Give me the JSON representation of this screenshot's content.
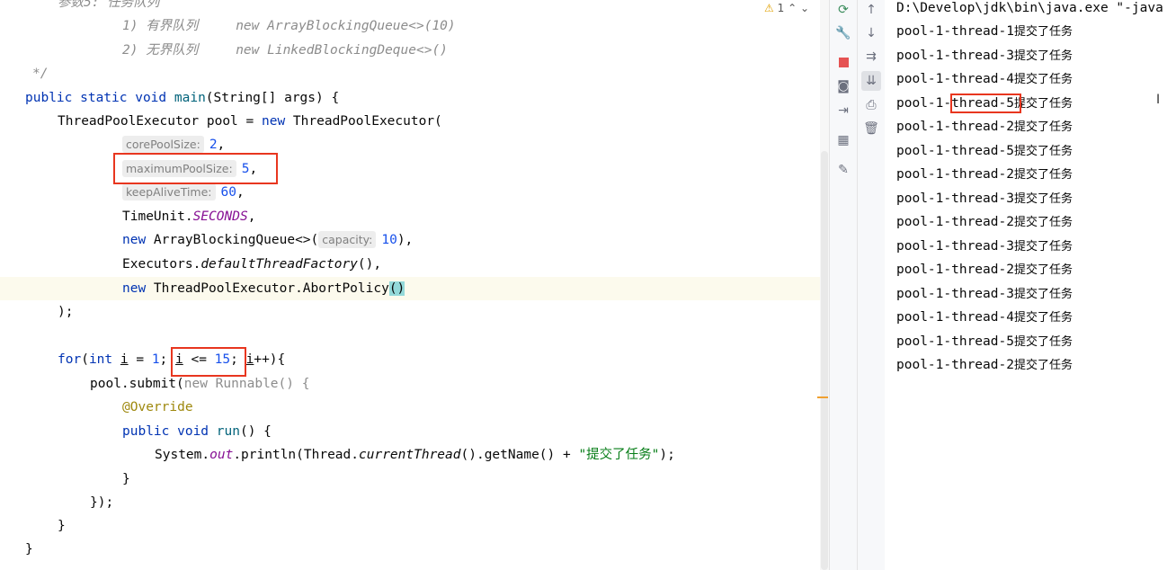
{
  "editor": {
    "warnings_count": "1",
    "lines": {
      "l0": "参数5: 任务队列",
      "l1_num": "1)",
      "l1_desc": "有界队列",
      "l1_code": "new ArrayBlockingQueue<>(10)",
      "l2_num": "2)",
      "l2_desc": "无界队列",
      "l2_code": "new LinkedBlockingDeque<>()",
      "l3": "*/",
      "main_sig_kw": "public static void ",
      "main_sig_name": "main",
      "main_sig_rest": "(String[] args) {",
      "decl_type": "ThreadPoolExecutor pool = ",
      "decl_new": "new",
      "decl_ctor": " ThreadPoolExecutor(",
      "p1_hint": "corePoolSize:",
      "p1_val": "2",
      "p2_hint": "maximumPoolSize:",
      "p2_val": "5",
      "p3_hint": "keepAliveTime:",
      "p3_val": "60",
      "p4_a": "TimeUnit.",
      "p4_b": "SECONDS",
      "p5_new": "new",
      "p5_a": " ArrayBlockingQueue<>(",
      "p5_hint": "capacity:",
      "p5_val": "10",
      "p6_a": "Executors.",
      "p6_b": "defaultThreadFactory",
      "p6_c": "(),",
      "p7_new": "new",
      "p7_a": " ThreadPoolExecutor.AbortPolicy",
      "p7_paren": "()",
      "close_ctor": ");",
      "for_kw": "for",
      "for_a": "(",
      "for_int": "int",
      "for_var": "i",
      "for_eq": " = ",
      "for_one": "1",
      "for_semi": ";",
      "for_cond_var": "i",
      "for_cond_op": " <= ",
      "for_cond_num": "15",
      "for_inc_var": "i",
      "for_inc": "++){",
      "submit_a": "pool.submit(",
      "submit_b": "new Runnable() {",
      "override": "@Override",
      "run_kw": "public void ",
      "run_name": "run",
      "run_rest": "() {",
      "print_a": "System.",
      "print_out": "out",
      "print_b": ".println(Thread.",
      "print_c": "currentThread",
      "print_d": "().getName() + ",
      "print_str": "\"提交了任务\"",
      "print_e": ");",
      "close_run": "}",
      "close_submit": "});",
      "close_for": "}",
      "close_main": "}"
    }
  },
  "toolbar": {
    "icons": [
      "rerun-icon",
      "up-arrow-icon",
      "wrench-icon",
      "down-arrow-icon",
      "soft-wrap-icon",
      "stop-icon",
      "scroll-to-end-icon",
      "camera-icon",
      "print-icon",
      "exit-icon",
      "trash-icon",
      "layout-icon",
      "pin-icon"
    ]
  },
  "console": {
    "header": "D:\\Develop\\jdk\\bin\\java.exe \"-java",
    "suffix": "提交了任务",
    "threads": [
      "pool-1-thread-1",
      "pool-1-thread-3",
      "pool-1-thread-4",
      "pool-1-thread-5",
      "pool-1-thread-2",
      "pool-1-thread-5",
      "pool-1-thread-2",
      "pool-1-thread-3",
      "pool-1-thread-2",
      "pool-1-thread-3",
      "pool-1-thread-2",
      "pool-1-thread-3",
      "pool-1-thread-4",
      "pool-1-thread-5",
      "pool-1-thread-2"
    ]
  },
  "colors": {
    "keyword": "#0033b3",
    "string": "#067d17",
    "number": "#1750eb",
    "annotation": "#9e880d",
    "highlight_box": "#e8361f"
  }
}
